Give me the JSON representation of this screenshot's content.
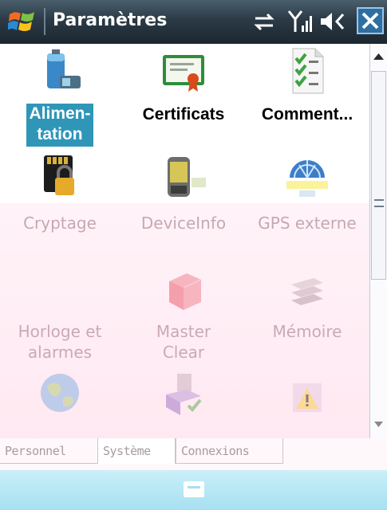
{
  "window": {
    "title": "Paramètres",
    "close_label": "✕"
  },
  "status_icons": [
    "data-sync-icon",
    "signal-icon",
    "volume-icon"
  ],
  "items": [
    {
      "label": "Alimen-\ntation",
      "icon": "battery-icon",
      "selected": true
    },
    {
      "label": "Certificats",
      "icon": "certificate-icon"
    },
    {
      "label": "Comment...",
      "icon": "checklist-icon"
    },
    {
      "label": "Cryptage",
      "icon": "encryption-icon"
    },
    {
      "label": "DeviceInfo",
      "icon": "device-icon"
    },
    {
      "label": "GPS externe",
      "icon": "gps-icon"
    },
    {
      "label": "Horloge et\nalarmes",
      "icon": "clock-icon"
    },
    {
      "label": "Master\nClear",
      "icon": "master-clear-icon"
    },
    {
      "label": "Mémoire",
      "icon": "memory-icon"
    },
    {
      "label": "",
      "icon": "globe-icon"
    },
    {
      "label": "",
      "icon": "screen-icon"
    },
    {
      "label": "",
      "icon": "warning-icon"
    }
  ],
  "tabs": [
    "Personnel",
    "Système",
    "Connexions"
  ],
  "active_tab": "Système",
  "colors": {
    "titlebar": "#1b2730",
    "selection": "#2f96b8",
    "faded_label": "#a88b93",
    "menubar": "#a7e0f1"
  }
}
